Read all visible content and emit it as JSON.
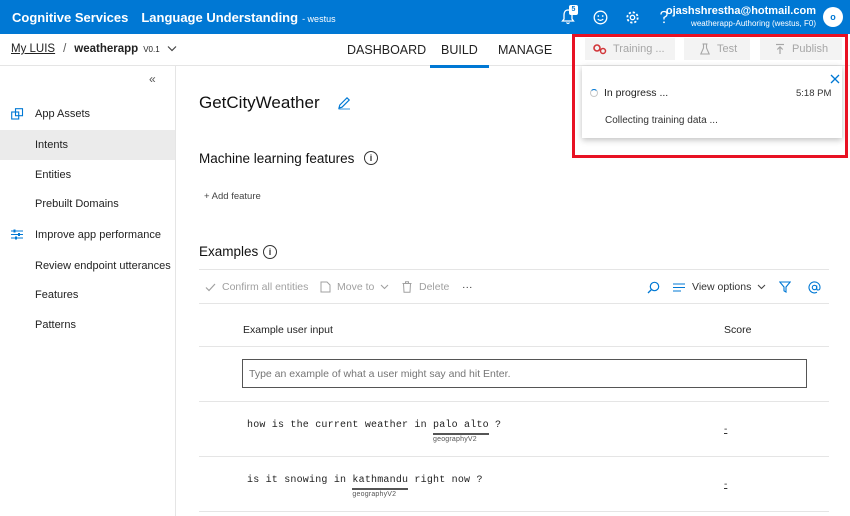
{
  "header": {
    "brand": "Cognitive Services",
    "product": "Language Understanding",
    "region": "- westus",
    "notification_count": "5",
    "account_email": "ojashshrestha@hotmail.com",
    "account_sub": "weatherapp-Authoring (westus, F0)",
    "avatar_initial": "o",
    "icons": [
      "bell-icon",
      "smiley-icon",
      "gear-icon",
      "help-icon"
    ]
  },
  "breadcrumb": {
    "root": "My LUIS",
    "separator": "/",
    "app": "weatherapp",
    "version": "V0.1"
  },
  "nav": {
    "tabs": [
      "DASHBOARD",
      "BUILD",
      "MANAGE"
    ],
    "active_tab": "BUILD",
    "training_label": "Training ...",
    "test_label": "Test",
    "publish_label": "Publish"
  },
  "sidebar": {
    "collapse_glyph": "«",
    "items": [
      {
        "label": "App Assets",
        "icon": "assets-icon"
      },
      {
        "label": "Intents"
      },
      {
        "label": "Entities"
      },
      {
        "label": "Prebuilt Domains"
      },
      {
        "label": "Improve app performance",
        "icon": "sliders-icon"
      },
      {
        "label": "Review endpoint utterances"
      },
      {
        "label": "Features"
      },
      {
        "label": "Patterns"
      }
    ],
    "selected": "Intents"
  },
  "main": {
    "intent_name": "GetCityWeather",
    "ml_features_title": "Machine learning features",
    "add_feature": "+ Add feature",
    "examples_title": "Examples",
    "toolbar": {
      "confirm": "Confirm all entities",
      "move_to": "Move to",
      "delete": "Delete",
      "more": "···",
      "view_options": "View options"
    },
    "columns": {
      "input": "Example user input",
      "score": "Score"
    },
    "input_placeholder": "Type an example of what a user might say and hit Enter.",
    "utterances": [
      {
        "before": "how is the current weather in ",
        "entity": "palo alto",
        "after": " ?",
        "entity_type": "geographyV2",
        "score": "-"
      },
      {
        "before": "is it snowing in ",
        "entity": "kathmandu",
        "after": " right now ?",
        "entity_type": "geographyV2",
        "score": "-"
      }
    ]
  },
  "notification": {
    "status": "In progress ...",
    "time": "5:18 PM",
    "message": "Collecting training data ..."
  },
  "colors": {
    "accent": "#0078d4",
    "highlight": "#e81123"
  }
}
